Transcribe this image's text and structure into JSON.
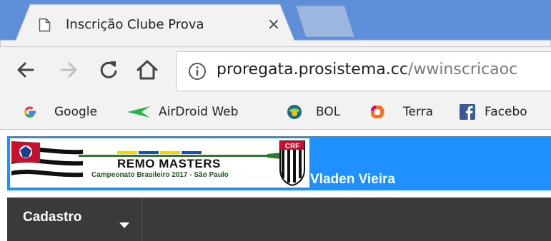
{
  "browser": {
    "tab": {
      "title": "Inscrição Clube Prova",
      "close_symbol": "×"
    },
    "address": {
      "host": "proregata.prosistema.cc",
      "path": "/wwinscricaoc"
    },
    "bookmarks": [
      {
        "label": "Google",
        "icon": "google-g-icon"
      },
      {
        "label": "AirDroid Web",
        "icon": "airdroid-icon"
      },
      {
        "label": "BOL",
        "icon": "bol-icon"
      },
      {
        "label": "Terra",
        "icon": "terra-icon"
      },
      {
        "label": "Facebo",
        "icon": "facebook-icon"
      }
    ]
  },
  "page": {
    "banner": {
      "title": "REMO MASTERS",
      "subtitle": "Campeonato Brasileiro 2017 - São Paulo",
      "crest_text": "CRF"
    },
    "user_name": "Vladen Vieira",
    "nav": {
      "menu_label": "Cadastro"
    }
  },
  "colors": {
    "tab_strip": "#5f8ed8",
    "toolbar": "#f2f2f2",
    "header": "#1e90ff",
    "navbar": "#3a3a3a"
  }
}
